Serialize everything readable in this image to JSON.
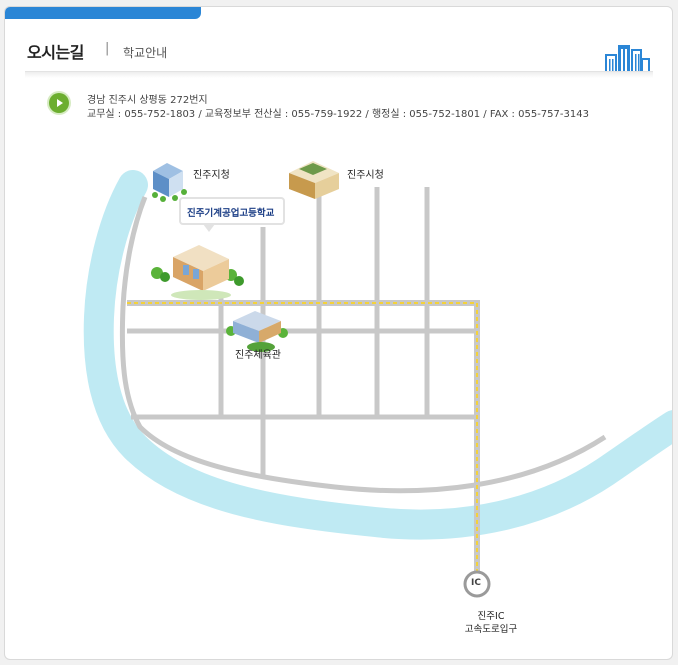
{
  "header": {
    "title": "오시는길",
    "separator": "|",
    "breadcrumb": "학교안내"
  },
  "address": {
    "line1": "경남 진주시 상평동 272번지",
    "line2": "교무실 : 055-752-1803 / 교육정보부 전산실 : 055-759-1922 / 행정실 : 055-752-1801 / FAX : 055-757-3143"
  },
  "map": {
    "landmarks": {
      "jinju_branch": "진주지청",
      "city_hall": "진주시청",
      "school": "진주기계공업고등학교",
      "gym": "진주체육관",
      "ic_badge": "IC",
      "ic_line1": "진주IC",
      "ic_line2": "고속도로입구"
    },
    "colors": {
      "river": "#bfeaf3",
      "road": "#c8c8c8",
      "highway": "#f4d23a",
      "accent": "#2b86d6",
      "arrow": "#6cae2f"
    }
  }
}
